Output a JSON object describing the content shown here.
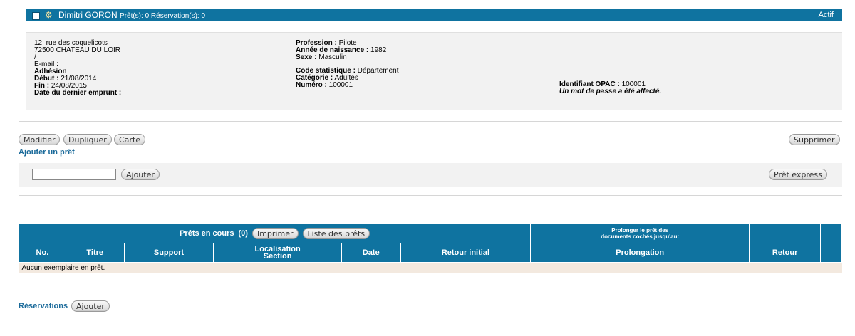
{
  "header": {
    "patron_name": "Dimitri GORON",
    "counts": "Prêt(s): 0 Réservation(s): 0",
    "status": "Actif",
    "toggle_icon": "collapse-icon",
    "patron_icon": "basket-icon"
  },
  "info": {
    "address_line1": "12, rue des coquelicots",
    "address_line2": "72500 CHATEAU DU LOIR",
    "address_line3": "/",
    "email_label": "E-mail :",
    "adhesion_label": "Adhésion",
    "debut_label": "Début :",
    "debut_value": " 21/08/2014",
    "fin_label": "Fin :",
    "fin_value": " 24/08/2015",
    "last_loan_label": "Date du dernier emprunt :",
    "profession_label": "Profession :",
    "profession_value": " Pilote",
    "birth_label": "Année de naissance :",
    "birth_value": " 1982",
    "sex_label": "Sexe :",
    "sex_value": " Masculin",
    "stat_code_label": "Code statistique :",
    "stat_code_value": " Département",
    "category_label": "Catégorie :",
    "category_value": " Adultes",
    "number_label": "Numéro :",
    "number_value": " 100001",
    "opac_label": "Identifiant OPAC :",
    "opac_value": " 100001",
    "password_note": "Un mot de passe a été affecté."
  },
  "actions": {
    "modify": "Modifier",
    "duplicate": "Dupliquer",
    "card": "Carte",
    "delete": "Supprimer",
    "add_loan_link": "Ajouter un prêt",
    "add": "Ajouter",
    "express_loan": "Prêt express",
    "barcode_value": ""
  },
  "loans": {
    "title": "Prêts en cours",
    "count": "(0)",
    "print": "Imprimer",
    "list": "Liste des prêts",
    "extend_line1": "Prolonger le prêt des",
    "extend_line2": "documents cochés jusqu'au:",
    "columns": {
      "no": "No.",
      "title": "Titre",
      "support": "Support",
      "location_line1": "Localisation",
      "location_line2": "Section",
      "date": "Date",
      "initial_return": "Retour initial",
      "extension": "Prolongation",
      "return": "Retour"
    },
    "empty_message": "Aucun exemplaire en prêt."
  },
  "reservations": {
    "label": "Réservations",
    "add": "Ajouter"
  }
}
